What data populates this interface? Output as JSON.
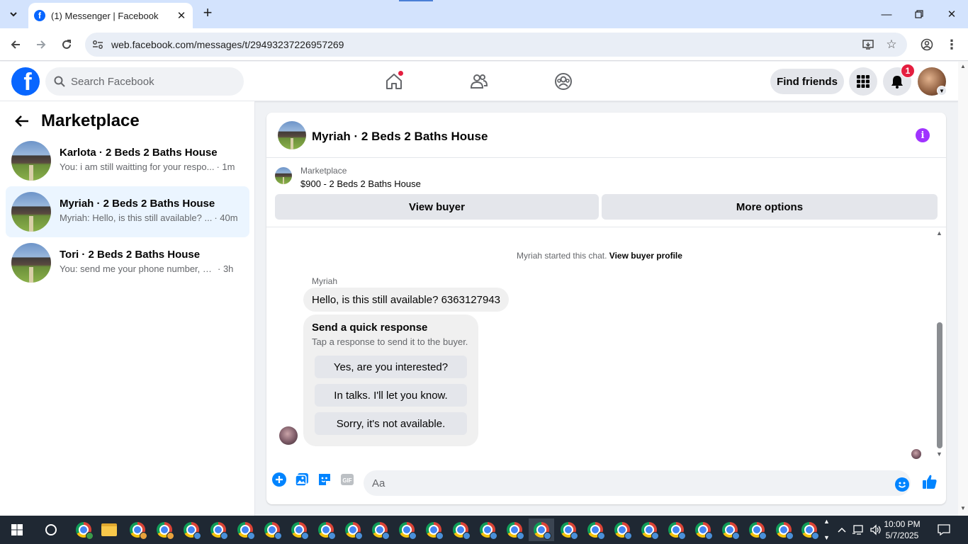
{
  "browser": {
    "tab_title": "(1) Messenger | Facebook",
    "url": "web.facebook.com/messages/t/29493237226957269"
  },
  "fb": {
    "search_placeholder": "Search Facebook",
    "find_friends": "Find friends",
    "notification_count": "1"
  },
  "sidebar": {
    "title": "Marketplace",
    "conversations": [
      {
        "name": "Karlota · 2 Beds 2 Baths House",
        "preview": "You: i am still waitting for your respo...",
        "time": "· 1m",
        "active": false
      },
      {
        "name": "Myriah · 2 Beds 2 Baths House",
        "preview": "Myriah: Hello, is this still available? ...",
        "time": "· 40m",
        "active": true
      },
      {
        "name": "Tori · 2 Beds 2 Baths House",
        "preview": "You: send me your phone number, an...",
        "time": "· 3h",
        "active": false
      }
    ]
  },
  "chat": {
    "title": "Myriah · 2 Beds 2 Baths House",
    "listing_category": "Marketplace",
    "listing_title": "$900 - 2 Beds 2 Baths House",
    "view_buyer": "View buyer",
    "more_options": "More options",
    "started_text": "Myriah started this chat.",
    "view_profile": "View buyer profile",
    "sender": "Myriah",
    "message": "Hello, is this still available? 6363127943",
    "quick_title": "Send a quick response",
    "quick_subtitle": "Tap a response to send it to the buyer.",
    "quick_replies": [
      "Yes, are you interested?",
      "In talks. I'll let you know.",
      "Sorry, it's not available."
    ],
    "input_placeholder": "Aa"
  },
  "taskbar": {
    "time": "10:00 PM",
    "date": "5/7/2025"
  },
  "colors": {
    "fb_blue": "#0866ff",
    "messenger_blue": "#0084ff",
    "notification_red": "#e41e3f",
    "info_purple": "#a033ff"
  }
}
